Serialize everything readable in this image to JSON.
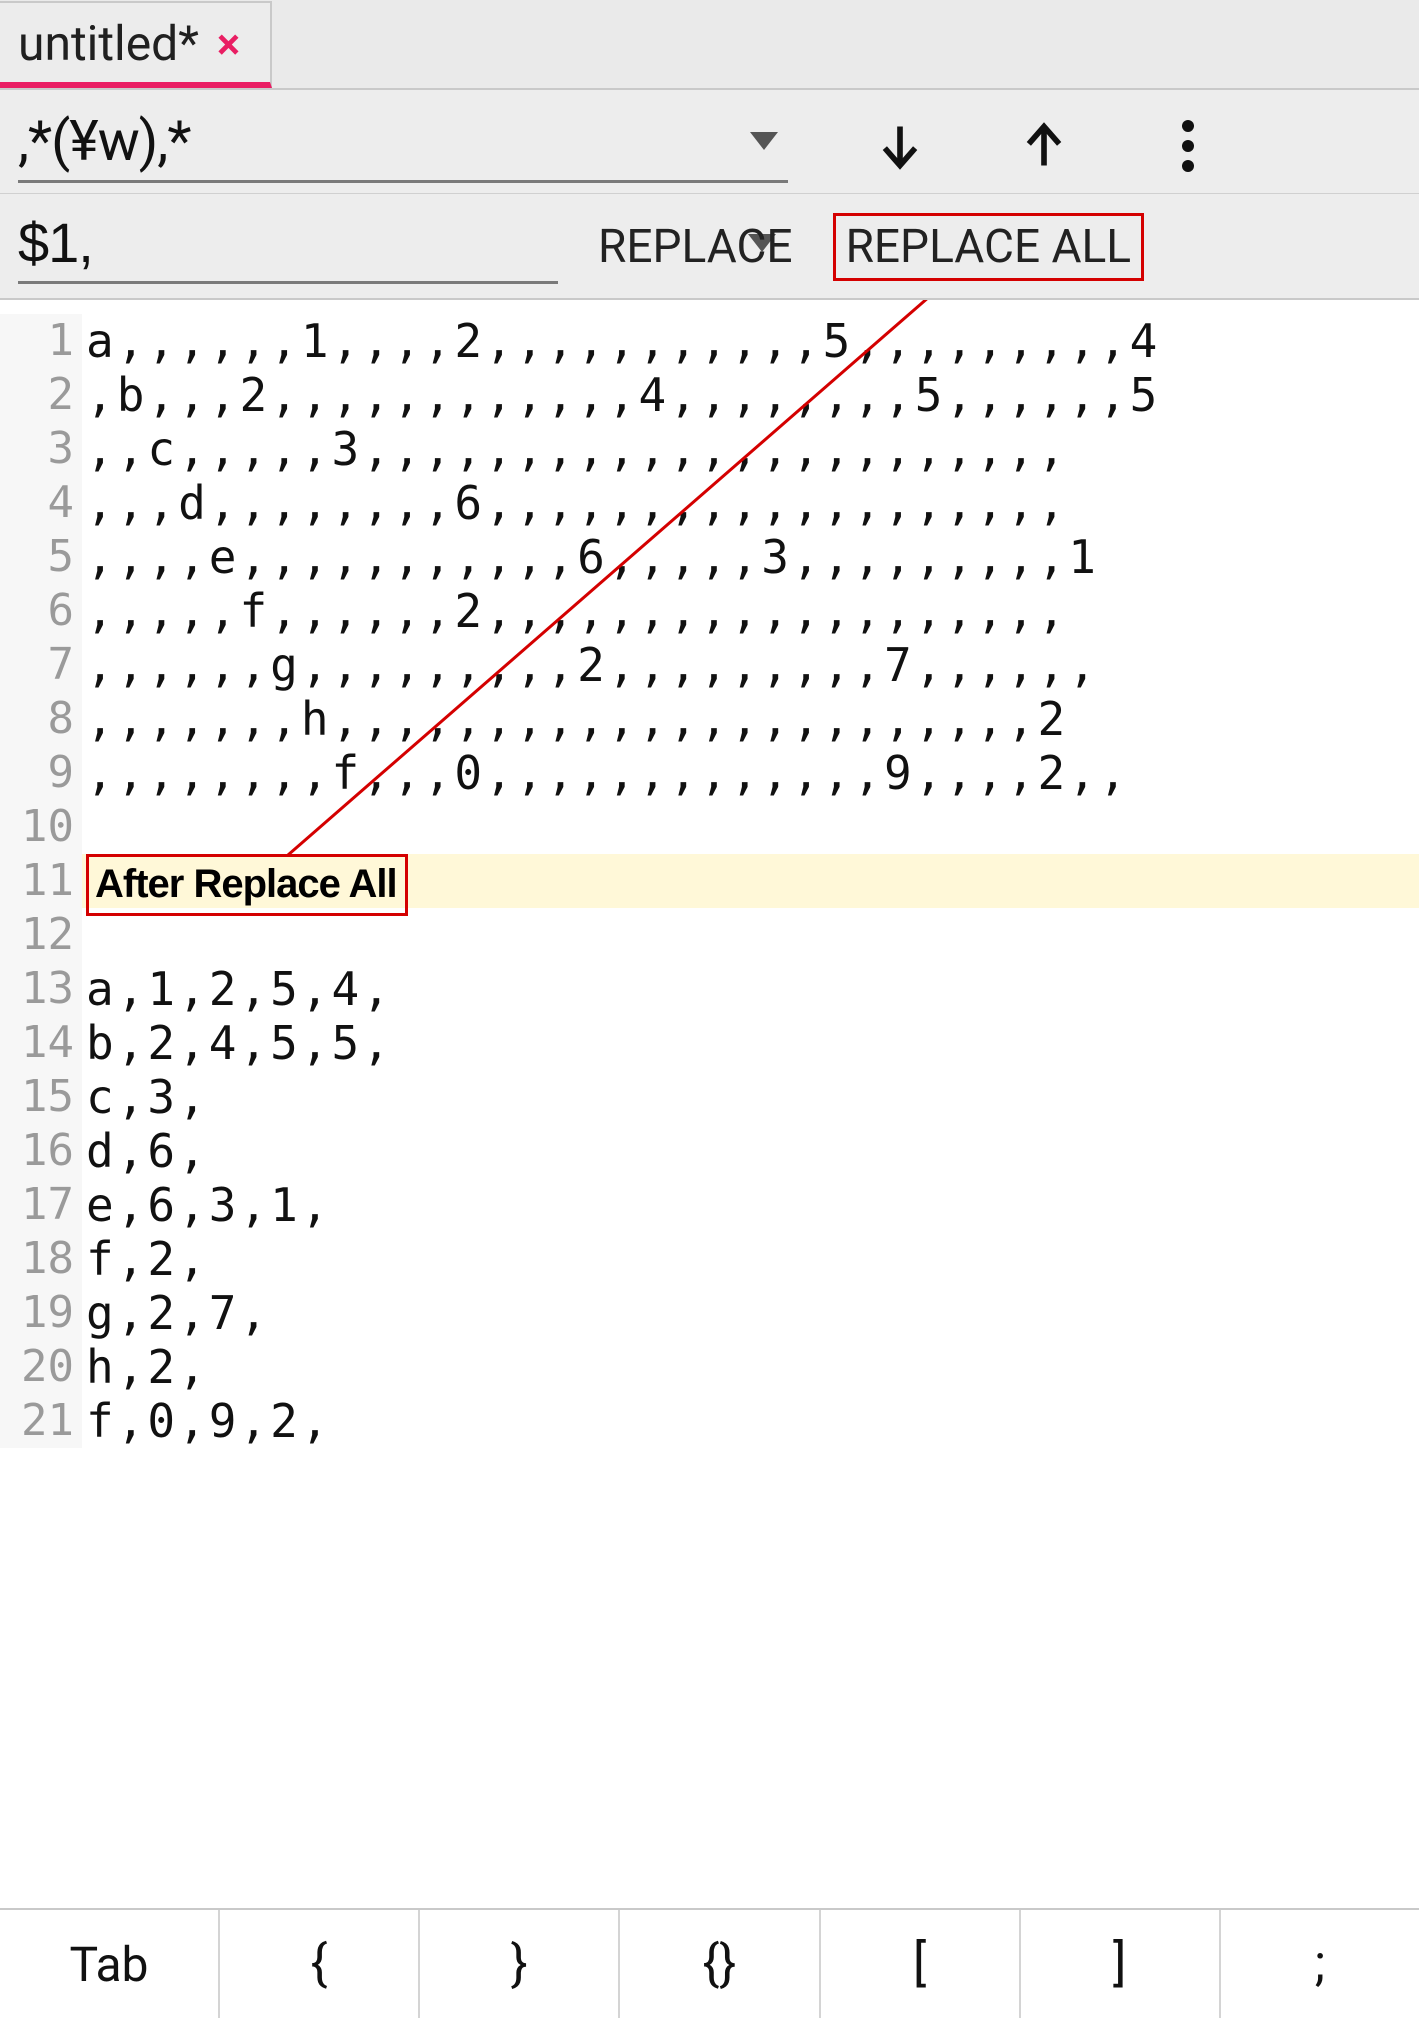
{
  "tab": {
    "title": "untitled*",
    "close_glyph": "×"
  },
  "search": {
    "value": ",*(¥w),*"
  },
  "replace": {
    "value": "$1,",
    "replace_label": "REPLACE",
    "replace_all_label": "REPLACE ALL"
  },
  "annotation": {
    "label": "After Replace All"
  },
  "editor_lines": [
    "a,,,,,,1,,,,2,,,,,,,,,,,5,,,,,,,,,4",
    ",b,,,2,,,,,,,,,,,,4,,,,,,,,5,,,,,,5",
    ",,c,,,,,3,,,,,,,,,,,,,,,,,,,,,,,",
    ",,,d,,,,,,,,6,,,,,,,,,,,,,,,,,,,",
    ",,,,e,,,,,,,,,,,6,,,,,3,,,,,,,,,1",
    ",,,,,f,,,,,,2,,,,,,,,,,,,,,,,,,,",
    ",,,,,,g,,,,,,,,,2,,,,,,,,,7,,,,,,",
    ",,,,,,,h,,,,,,,,,,,,,,,,,,,,,,,2",
    ",,,,,,,,f,,,0,,,,,,,,,,,,,9,,,,2,,",
    "",
    "__ANNOTATION__",
    "",
    "a,1,2,5,4,",
    "b,2,4,5,5,",
    "c,3,",
    "d,6,",
    "e,6,3,1,",
    "f,2,",
    "g,2,7,",
    "h,2,",
    "f,0,9,2,"
  ],
  "keys": [
    "Tab",
    "{",
    "}",
    "{}",
    "[",
    "]",
    ";"
  ]
}
